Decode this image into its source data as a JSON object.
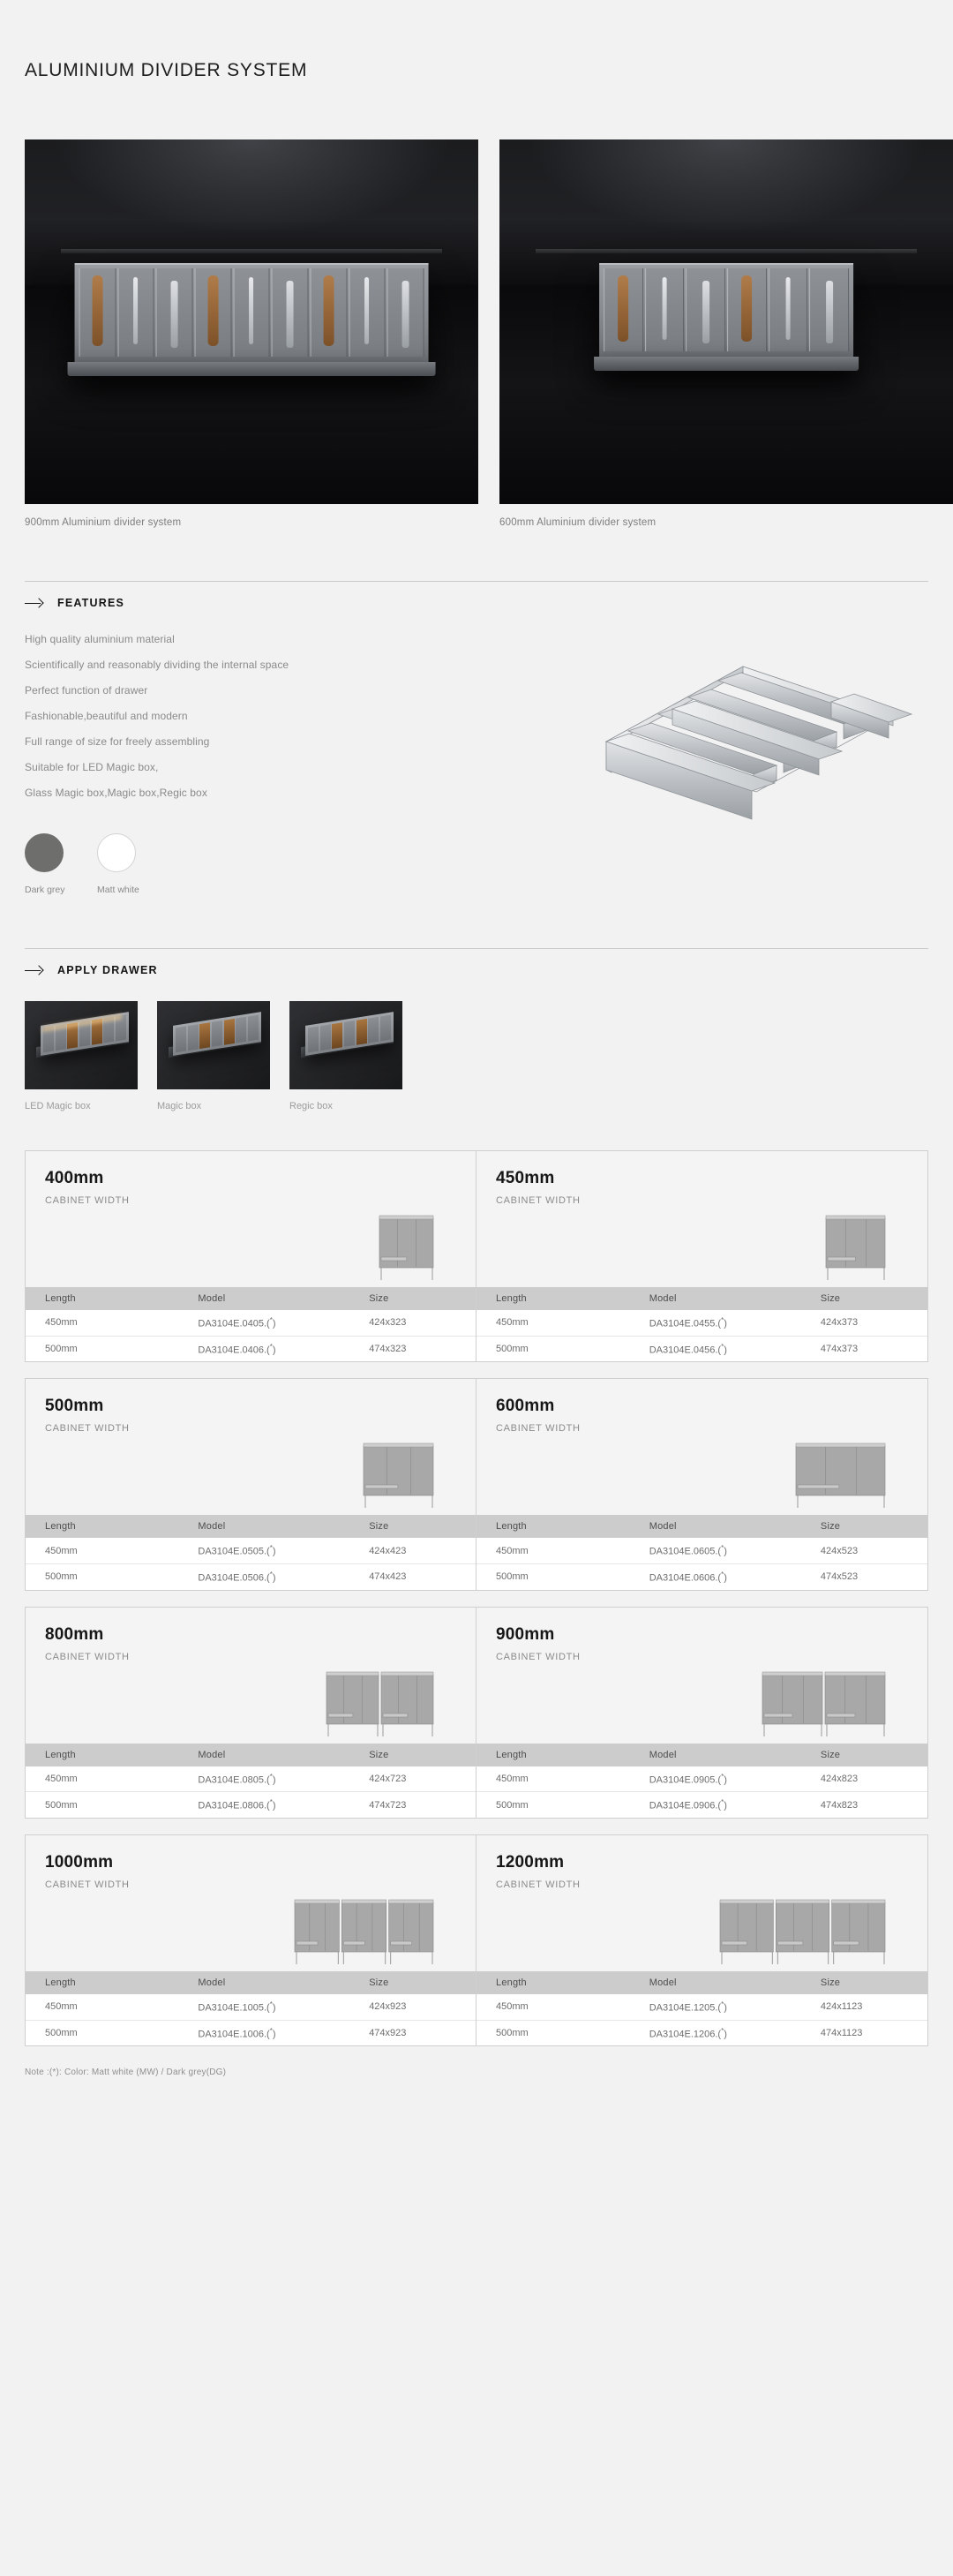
{
  "page": {
    "title": "ALUMINIUM DIVIDER SYSTEM"
  },
  "hero": {
    "items": [
      {
        "caption": "900mm Aluminium divider system",
        "size": "900"
      },
      {
        "caption": "600mm Aluminium divider system",
        "size": "600"
      }
    ]
  },
  "features": {
    "heading": "FEATURES",
    "arrow_icon": "arrow-right-icon",
    "items": [
      "High quality aluminium material",
      "Scientifically and reasonably dividing the internal space",
      "Perfect function of drawer",
      "Fashionable,beautiful and modern",
      "Full range of size for freely assembling",
      "Suitable for LED Magic box,",
      "Glass Magic box,Magic box,Regic box"
    ],
    "colors": [
      {
        "label": "Dark grey",
        "hex": "#6e6e6d"
      },
      {
        "label": "Matt white",
        "hex": "#ffffff"
      }
    ]
  },
  "apply_drawer": {
    "heading": "APPLY DRAWER",
    "arrow_icon": "arrow-right-icon",
    "items": [
      {
        "caption": "LED Magic box"
      },
      {
        "caption": "Magic box"
      },
      {
        "caption": "Regic box"
      }
    ]
  },
  "spec_table_headers": {
    "length": "Length",
    "model": "Model",
    "size": "Size"
  },
  "spec_cards": [
    {
      "width": "400mm",
      "subtitle": "CABINET WIDTH",
      "compartments": 1,
      "art_width": 64,
      "rows": [
        {
          "length": "450mm",
          "model": "DA3104E.0405.(",
          "model_suffix": ")",
          "size": "424x323"
        },
        {
          "length": "500mm",
          "model": "DA3104E.0406.(",
          "model_suffix": ")",
          "size": "474x323"
        }
      ]
    },
    {
      "width": "450mm",
      "subtitle": "CABINET WIDTH",
      "compartments": 1,
      "art_width": 70,
      "rows": [
        {
          "length": "450mm",
          "model": "DA3104E.0455.(",
          "model_suffix": ")",
          "size": "424x373"
        },
        {
          "length": "500mm",
          "model": "DA3104E.0456.(",
          "model_suffix": ")",
          "size": "474x373"
        }
      ]
    },
    {
      "width": "500mm",
      "subtitle": "CABINET WIDTH",
      "compartments": 1,
      "art_width": 82,
      "rows": [
        {
          "length": "450mm",
          "model": "DA3104E.0505.(",
          "model_suffix": ")",
          "size": "424x423"
        },
        {
          "length": "500mm",
          "model": "DA3104E.0506.(",
          "model_suffix": ")",
          "size": "474x423"
        }
      ]
    },
    {
      "width": "600mm",
      "subtitle": "CABINET WIDTH",
      "compartments": 1,
      "art_width": 104,
      "rows": [
        {
          "length": "450mm",
          "model": "DA3104E.0605.(",
          "model_suffix": ")",
          "size": "424x523"
        },
        {
          "length": "500mm",
          "model": "DA3104E.0606.(",
          "model_suffix": ")",
          "size": "474x523"
        }
      ]
    },
    {
      "width": "800mm",
      "subtitle": "CABINET WIDTH",
      "compartments": 2,
      "art_width": 124,
      "rows": [
        {
          "length": "450mm",
          "model": "DA3104E.0805.(",
          "model_suffix": ")",
          "size": "424x723"
        },
        {
          "length": "500mm",
          "model": "DA3104E.0806.(",
          "model_suffix": ")",
          "size": "474x723"
        }
      ]
    },
    {
      "width": "900mm",
      "subtitle": "CABINET WIDTH",
      "compartments": 2,
      "art_width": 142,
      "rows": [
        {
          "length": "450mm",
          "model": "DA3104E.0905.(",
          "model_suffix": ")",
          "size": "424x823"
        },
        {
          "length": "500mm",
          "model": "DA3104E.0906.(",
          "model_suffix": ")",
          "size": "474x823"
        }
      ]
    },
    {
      "width": "1000mm",
      "subtitle": "CABINET WIDTH",
      "compartments": 3,
      "art_width": 160,
      "rows": [
        {
          "length": "450mm",
          "model": "DA3104E.1005.(",
          "model_suffix": ")",
          "size": "424x923"
        },
        {
          "length": "500mm",
          "model": "DA3104E.1006.(",
          "model_suffix": ")",
          "size": "474x923"
        }
      ]
    },
    {
      "width": "1200mm",
      "subtitle": "CABINET WIDTH",
      "compartments": 3,
      "art_width": 190,
      "rows": [
        {
          "length": "450mm",
          "model": "DA3104E.1205.(",
          "model_suffix": ")",
          "size": "424x1123"
        },
        {
          "length": "500mm",
          "model": "DA3104E.1206.(",
          "model_suffix": ")",
          "size": "474x1123"
        }
      ]
    }
  ],
  "note": "Note :(*): Color: Matt white (MW) / Dark grey(DG)"
}
